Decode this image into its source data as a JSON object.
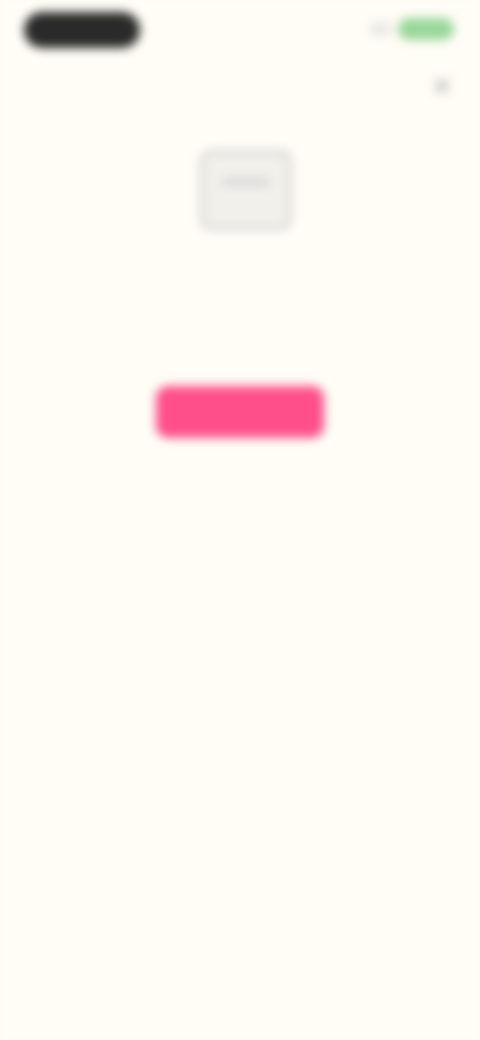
{
  "status_bar": {
    "signal_icon": "signal-icon",
    "battery_color": "#9ad79a"
  },
  "header": {
    "title": "",
    "close_icon": "close-icon"
  },
  "empty_state": {
    "illustration_icon": "empty-box-icon",
    "title": "",
    "description": "",
    "button_label": "",
    "button_color": "#ff4f8b"
  },
  "colors": {
    "background": "#fffdf6",
    "accent": "#ff4f8b"
  }
}
